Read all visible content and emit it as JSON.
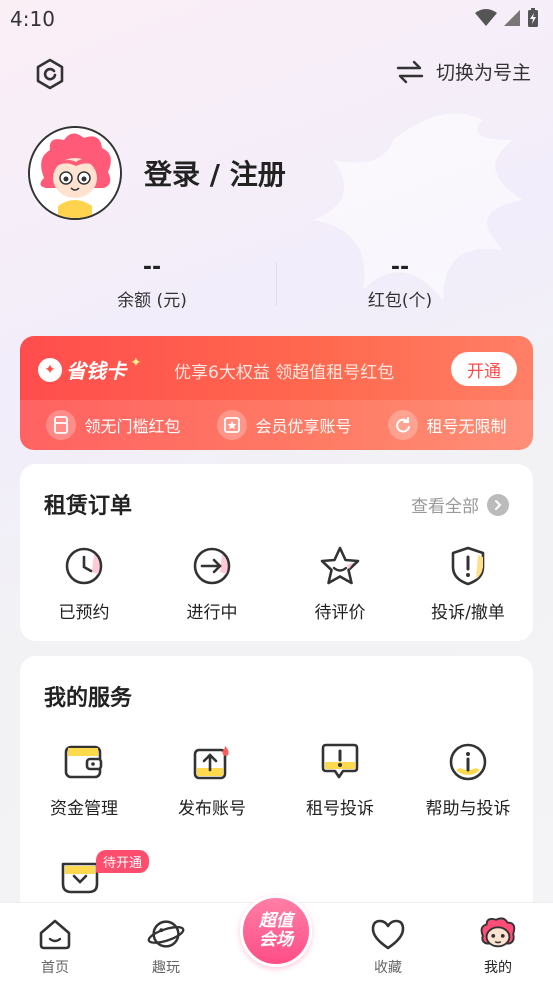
{
  "status_bar": {
    "time": "4:10"
  },
  "top_bar": {
    "switch_label": "切换为号主"
  },
  "profile": {
    "login_label": "登录 / 注册"
  },
  "stats": [
    {
      "value": "--",
      "label": "余额 (元)"
    },
    {
      "value": "--",
      "label": "红包(个)"
    }
  ],
  "vip": {
    "logo_text": "省钱卡",
    "description": "优享6大权益 领超值租号红包",
    "open_label": "开通",
    "perks": [
      {
        "label": "领无门槛红包",
        "icon": "coupon-icon"
      },
      {
        "label": "会员优享账号",
        "icon": "member-icon"
      },
      {
        "label": "租号无限制",
        "icon": "refresh-icon"
      }
    ]
  },
  "orders": {
    "title": "租赁订单",
    "view_all": "查看全部",
    "items": [
      {
        "label": "已预约",
        "icon": "clock-icon"
      },
      {
        "label": "进行中",
        "icon": "arrow-circle-icon"
      },
      {
        "label": "待评价",
        "icon": "star-icon"
      },
      {
        "label": "投诉/撤单",
        "icon": "shield-alert-icon"
      }
    ]
  },
  "services": {
    "title": "我的服务",
    "items": [
      {
        "label": "资金管理",
        "icon": "wallet-icon"
      },
      {
        "label": "发布账号",
        "icon": "upload-icon"
      },
      {
        "label": "租号投诉",
        "icon": "message-alert-icon"
      },
      {
        "label": "帮助与投诉",
        "icon": "info-icon"
      }
    ],
    "pending_badge": "待开通"
  },
  "tabs": [
    {
      "label": "首页",
      "icon": "home-icon"
    },
    {
      "label": "趣玩",
      "icon": "planet-icon"
    },
    {
      "label": "收藏",
      "icon": "heart-icon"
    },
    {
      "label": "我的",
      "icon": "profile-mascot-icon"
    }
  ],
  "center_tab": {
    "line1": "超值",
    "line2": "会场"
  },
  "colors": {
    "accent": "#ff4d4d",
    "pink": "#ff4d87"
  }
}
